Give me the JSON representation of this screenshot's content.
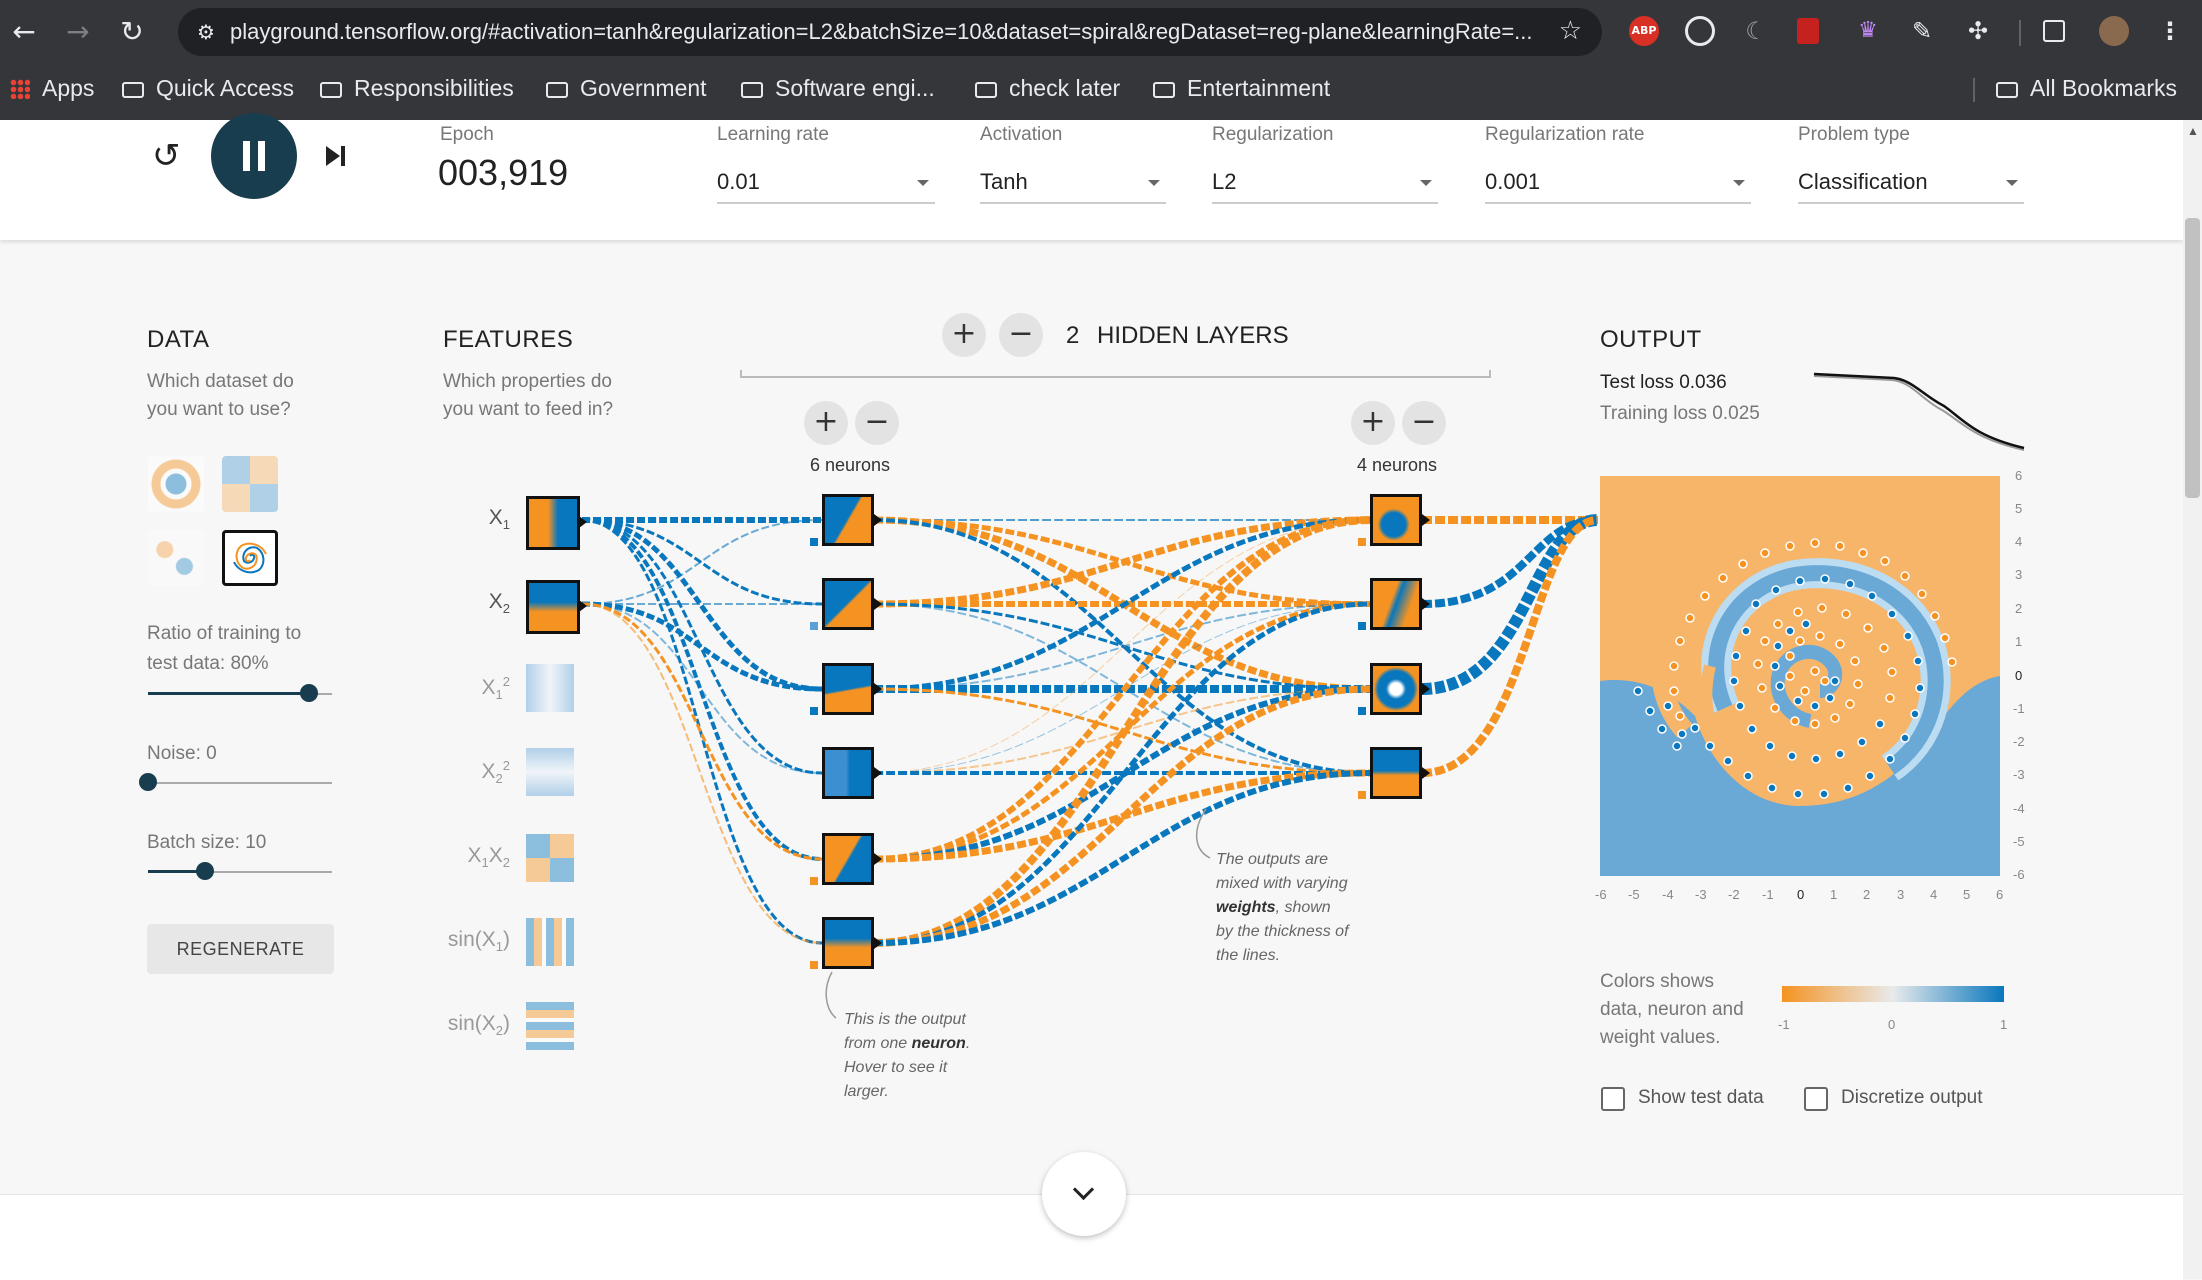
{
  "browser": {
    "url": "playground.tensorflow.org/#activation=tanh&regularization=L2&batchSize=10&dataset=spiral&regDataset=reg-plane&learningRate=...",
    "bookmarks": [
      "Apps",
      "Quick Access",
      "Responsibilities",
      "Government",
      "Software engi...",
      "check later",
      "Entertainment"
    ],
    "all_bookmarks": "All Bookmarks",
    "extension_abp": "ABP"
  },
  "controls": {
    "epoch_label": "Epoch",
    "epoch_value": "003,919",
    "learning_rate": {
      "label": "Learning rate",
      "value": "0.01"
    },
    "activation": {
      "label": "Activation",
      "value": "Tanh"
    },
    "regularization": {
      "label": "Regularization",
      "value": "L2"
    },
    "regularization_rate": {
      "label": "Regularization rate",
      "value": "0.001"
    },
    "problem_type": {
      "label": "Problem type",
      "value": "Classification"
    }
  },
  "data_panel": {
    "title": "DATA",
    "subtitle_line1": "Which dataset do",
    "subtitle_line2": "you want to use?",
    "ratio_label": "Ratio of training to",
    "ratio_label2": "test data:  80%",
    "ratio_value": 0.8,
    "noise_label": "Noise:  0",
    "noise_value": 0,
    "batch_label": "Batch size:  10",
    "batch_value": 10,
    "regenerate": "REGENERATE"
  },
  "features_panel": {
    "title": "FEATURES",
    "subtitle_line1": "Which properties do",
    "subtitle_line2": "you want to feed in?"
  },
  "network": {
    "hidden_layers_count": "2",
    "hidden_layers_label": "HIDDEN LAYERS",
    "layer1_neurons": "6 neurons",
    "layer2_neurons": "4 neurons",
    "annot_weights_1": "The outputs are",
    "annot_weights_2": "mixed with varying",
    "annot_weights_3b": "weights",
    "annot_weights_3": ", shown",
    "annot_weights_4": "by the thickness of",
    "annot_weights_5": "the lines.",
    "annot_neuron_1": "This is the output",
    "annot_neuron_2a": "from one ",
    "annot_neuron_2b": "neuron",
    "annot_neuron_2c": ".",
    "annot_neuron_3": "Hover to see it",
    "annot_neuron_4": "larger."
  },
  "output_panel": {
    "title": "OUTPUT",
    "test_loss_label": "Test loss",
    "test_loss": "0.036",
    "training_loss_label": "Training loss",
    "training_loss": "0.025",
    "axis_ticks": [
      "-6",
      "-5",
      "-4",
      "-3",
      "-2",
      "-1",
      "0",
      "1",
      "2",
      "3",
      "4",
      "5",
      "6"
    ],
    "y_axis_ticks": [
      "6",
      "5",
      "4",
      "3",
      "2",
      "1",
      "0",
      "-1",
      "-2",
      "-3",
      "-4",
      "-5",
      "-6"
    ],
    "legend_line1": "Colors shows",
    "legend_line2": "data, neuron and",
    "legend_line3": "weight values.",
    "legend_min": "-1",
    "legend_mid": "0",
    "legend_max": "1",
    "show_test_data": "Show test data",
    "discretize_output": "Discretize output"
  },
  "colors": {
    "orange": "#f59322",
    "blue": "#0877bd",
    "dark": "#183d4e"
  }
}
